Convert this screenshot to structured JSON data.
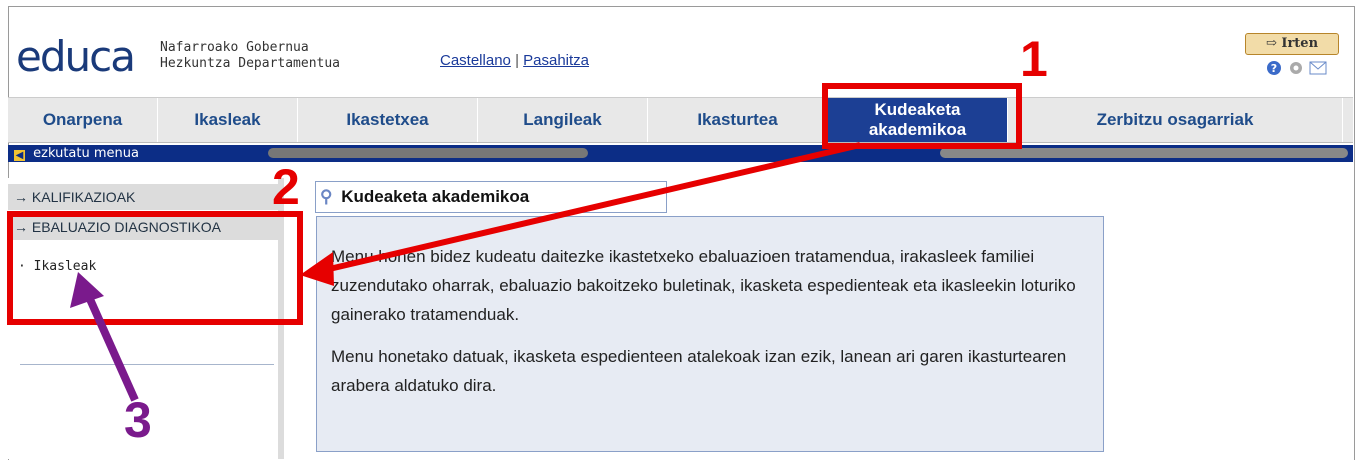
{
  "header": {
    "logo": "educa",
    "gov_line1": "Nafarroako Gobernua",
    "gov_line2": "Hezkuntza Departamentua",
    "lang_link": "Castellano",
    "sep": "|",
    "password_link": "Pasahitza",
    "exit_label": "Irten"
  },
  "tabs": [
    {
      "label": "Onarpena"
    },
    {
      "label": "Ikasleak"
    },
    {
      "label": "Ikastetxea"
    },
    {
      "label": "Langileak"
    },
    {
      "label": "Ikasturtea"
    },
    {
      "label": "Kudeaketa akademikoa"
    },
    {
      "label": "Zerbitzu osagarriak"
    }
  ],
  "subbar": {
    "hide_menu": "ezkutatu menua"
  },
  "sidebar": {
    "items": [
      {
        "label": "KALIFIKAZIOAK"
      },
      {
        "label": "EBALUAZIO DIAGNOSTIKOA"
      }
    ],
    "subitem": "Ikasleak"
  },
  "main": {
    "title": "Kudeaketa akademikoa",
    "paragraph1": "Menu honen bidez kudeatu daitezke ikastetxeko ebaluazioen tratamendua, irakasleek familiei zuzendutako oharrak, ebaluazio bakoitzeko buletinak, ikasketa espedienteak eta ikasleekin loturiko gainerako tratamenduak.",
    "paragraph2": "Menu honetako datuak, ikasketa espedienteen atalekoak izan ezik, lanean ari garen ikasturtearen arabera aldatuko dira."
  },
  "annotations": [
    "1",
    "2",
    "3"
  ],
  "colors": {
    "accent": "#1c3f94",
    "annotation_red": "#e60000",
    "annotation_purple": "#7a1a8c"
  }
}
